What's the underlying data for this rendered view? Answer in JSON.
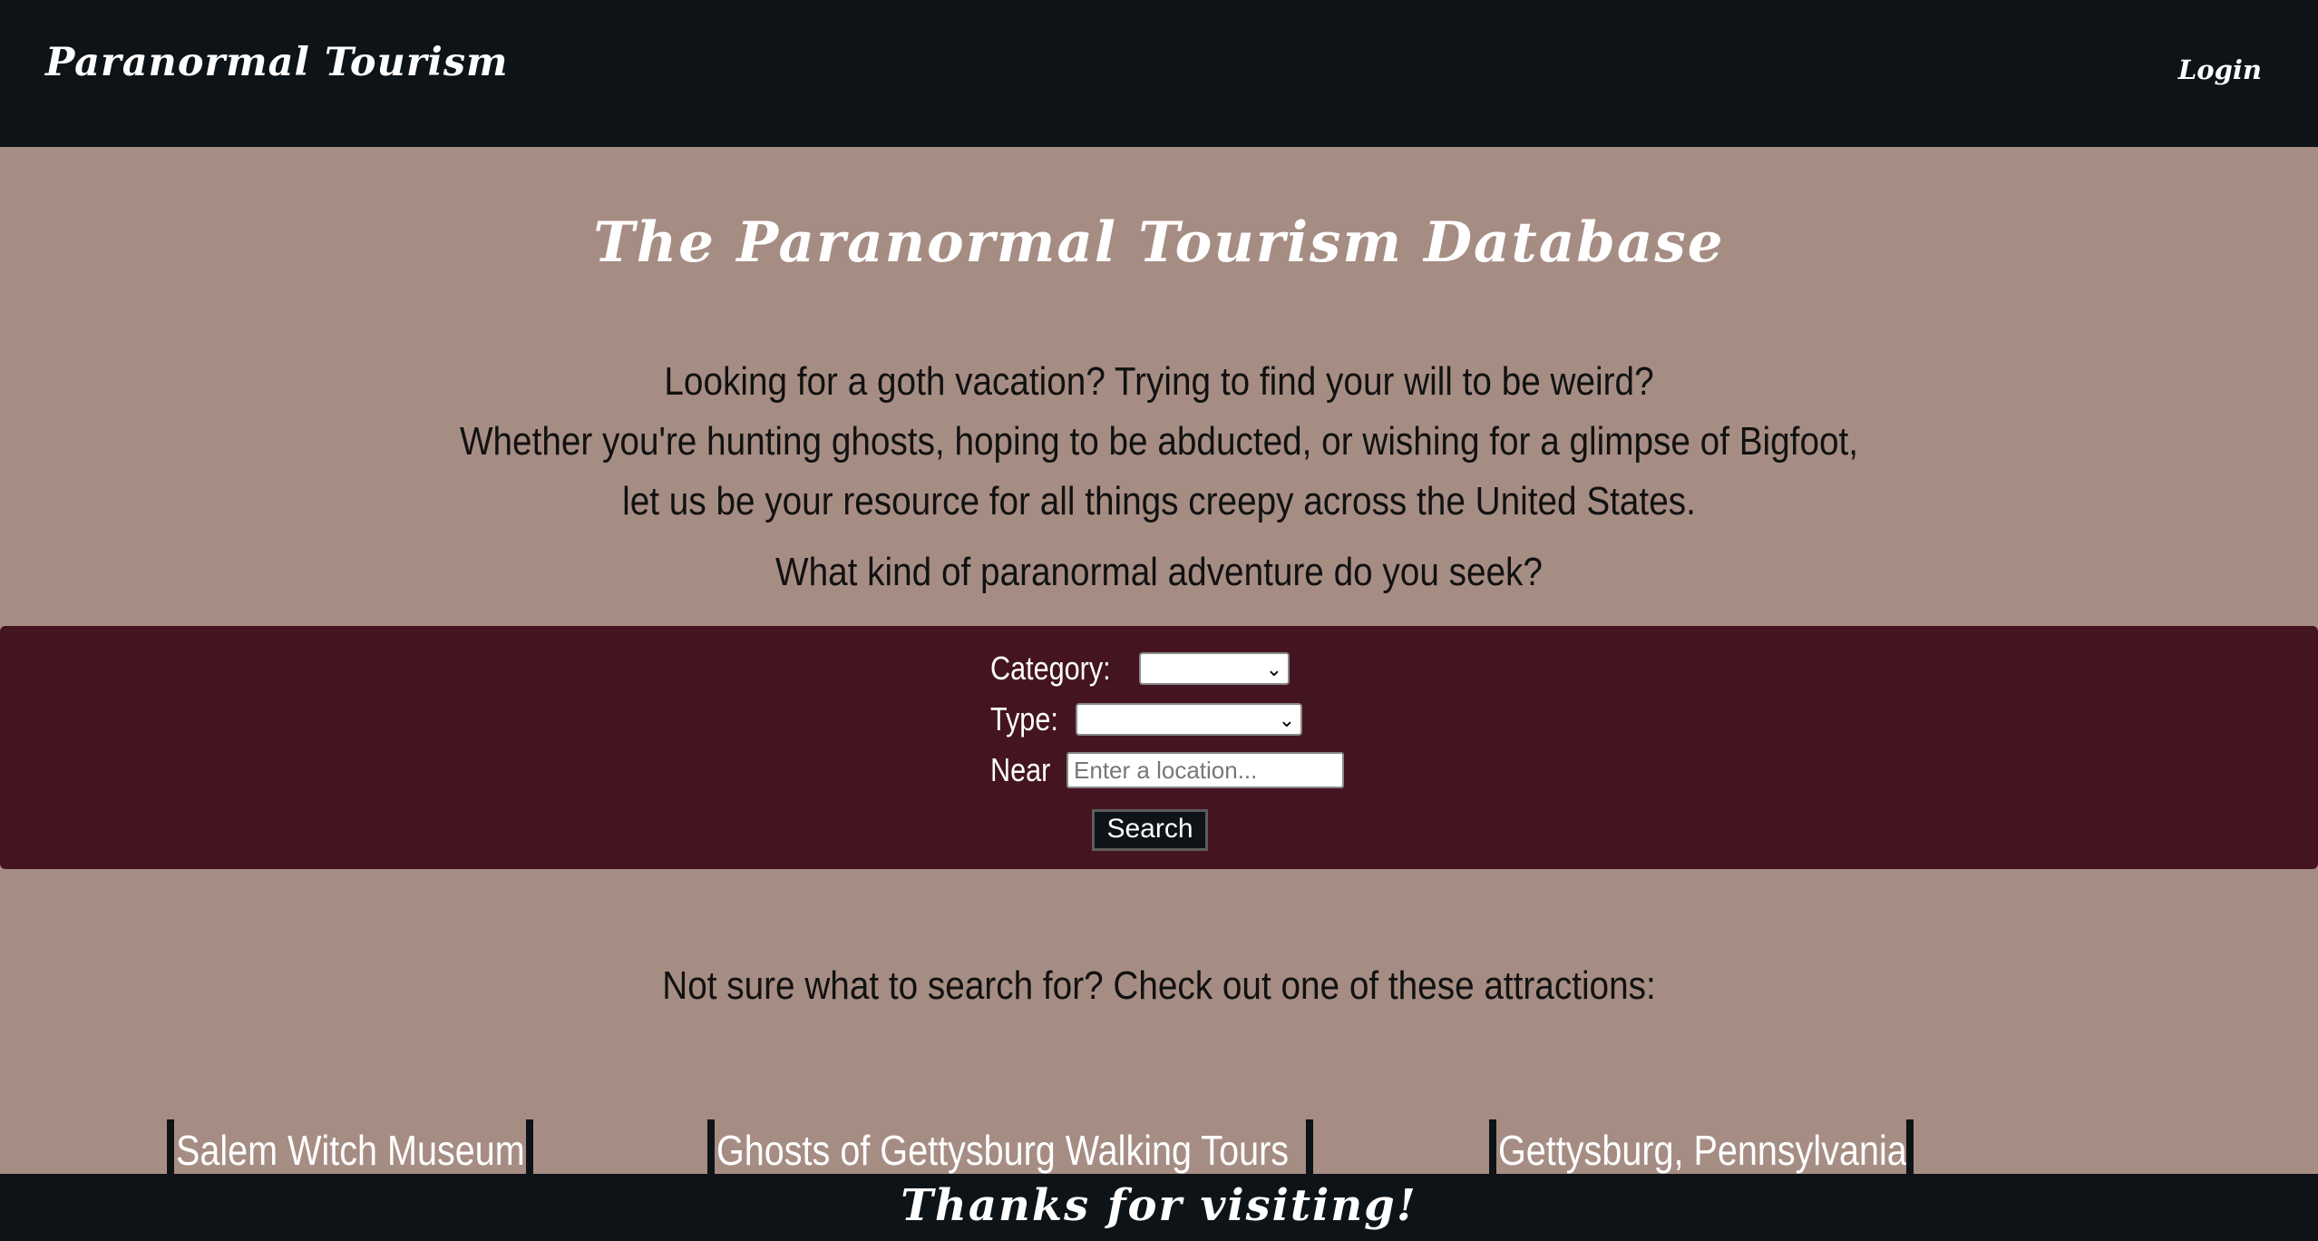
{
  "navbar": {
    "brand": "Paranormal Tourism",
    "login_label": "Login"
  },
  "main": {
    "title": "The Paranormal Tourism Database",
    "intro_lines": [
      "Looking for a goth vacation? Trying to find your will to be weird?",
      "Whether you're hunting ghosts, hoping to be abducted, or wishing for a glimpse of Bigfoot,",
      "let us be your resource for all things creepy across the United States."
    ],
    "question": "What kind of paranormal adventure do you seek?"
  },
  "search": {
    "category_label": "Category:",
    "category_value": "",
    "type_label": "Type:",
    "type_value": "",
    "near_label": "Near",
    "near_placeholder": "Enter a location...",
    "near_value": "",
    "button_label": "Search"
  },
  "suggestions": {
    "heading": "Not sure what to search for? Check out one of these attractions:",
    "items": [
      "Salem Witch Museum",
      "Ghosts of Gettysburg Walking Tours",
      "Gettysburg, Pennsylvania"
    ]
  },
  "footer": {
    "text": "Thanks for visiting!"
  },
  "colors": {
    "navbar_bg": "#0e1317",
    "page_bg": "#a68d83",
    "search_panel_bg": "#441520"
  }
}
